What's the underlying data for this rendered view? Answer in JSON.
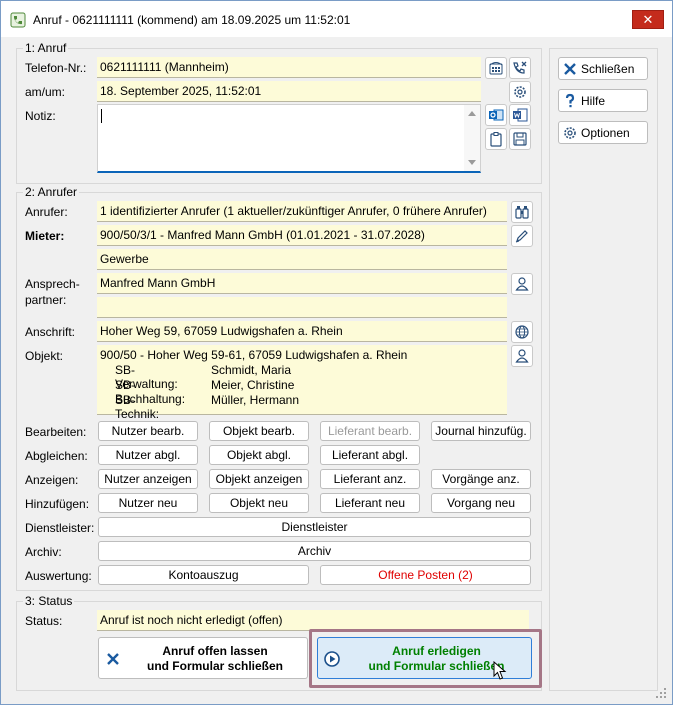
{
  "window": {
    "title": "Anruf - 0621111111 (kommend) am 18.09.2025 um 11:52:01",
    "close_symbol": "✕"
  },
  "anruf": {
    "section_title": "1: Anruf",
    "phone_label": "Telefon-Nr.:",
    "phone_value": "0621111111  (Mannheim)",
    "datetime_label": "am/um:",
    "datetime_value": "18. September 2025,  11:52:01",
    "note_label": "Notiz:",
    "note_value": ""
  },
  "anrufer": {
    "section_title": "2: Anrufer",
    "caller_label": "Anrufer:",
    "caller_value": "1 identifizierter Anrufer  (1 aktueller/zukünftiger Anrufer,  0 frühere Anrufer)",
    "tenant_label": "Mieter:",
    "tenant_value": "900/50/3/1 - Manfred Mann GmbH  (01.01.2021 - 31.07.2028)",
    "tenant_type": "Gewerbe",
    "contact_label_1": "Ansprech-",
    "contact_label_2": "partner:",
    "contact_value": "Manfred Mann GmbH",
    "contact_value_2": "",
    "address_label": "Anschrift:",
    "address_value": "Hoher Weg 59, 67059 Ludwigshafen a. Rhein",
    "object_label": "Objekt:",
    "object_value": "900/50 - Hoher Weg 59-61, 67059 Ludwigshafen a. Rhein",
    "object_staff": [
      {
        "role": "SB-Verwaltung:",
        "name": "Schmidt, Maria"
      },
      {
        "role": "SB-Buchhaltung:",
        "name": "Meier, Christine"
      },
      {
        "role": "SB-Technik:",
        "name": "Müller, Hermann"
      }
    ]
  },
  "actions": {
    "edit_label": "Bearbeiten:",
    "edit_buttons": [
      "Nutzer bearb.",
      "Objekt bearb.",
      "Lieferant bearb.",
      "Journal hinzufüg."
    ],
    "compare_label": "Abgleichen:",
    "compare_buttons": [
      "Nutzer abgl.",
      "Objekt abgl.",
      "Lieferant abgl."
    ],
    "show_label": "Anzeigen:",
    "show_buttons": [
      "Nutzer anzeigen",
      "Objekt anzeigen",
      "Lieferant anz.",
      "Vorgänge anz."
    ],
    "add_label": "Hinzufügen:",
    "add_buttons": [
      "Nutzer neu",
      "Objekt neu",
      "Lieferant neu",
      "Vorgang neu"
    ],
    "provider_label": "Dienstleister:",
    "provider_button": "Dienstleister",
    "archive_label": "Archiv:",
    "archive_button": "Archiv",
    "report_label": "Auswertung:",
    "report_buttons": [
      "Kontoauszug",
      "Offene Posten (2)"
    ]
  },
  "status": {
    "section_title": "3: Status",
    "status_label": "Status:",
    "status_value": "Anruf ist noch nicht erledigt (offen)",
    "leave_open_line1": "Anruf offen lassen",
    "leave_open_line2": "und Formular schließen",
    "complete_line1": "Anruf erledigen",
    "complete_line2": "und Formular schließen"
  },
  "sidebar": {
    "close_label": "Schließen",
    "help_label": "Hilfe",
    "options_label": "Optionen"
  },
  "colors": {
    "field_bg": "#fdfbd8",
    "accent_blue": "#0a64b8",
    "complete_green": "#008000",
    "warning_red": "#e00000",
    "highlight": "#a57686"
  }
}
